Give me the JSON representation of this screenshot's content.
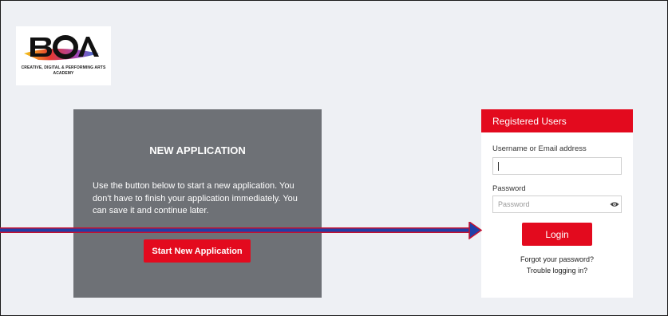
{
  "logo": {
    "tagline_line1": "CREATIVE, DIGITAL & PERFORMING ARTS",
    "tagline_line2": "ACADEMY"
  },
  "new_application": {
    "title": "NEW APPLICATION",
    "description": "Use the button below to start a new application. You don't have to finish your application immediately. You can save it and continue later.",
    "button_label": "Start New Application"
  },
  "login": {
    "header": "Registered Users",
    "username_label": "Username or Email address",
    "username_value": "",
    "password_label": "Password",
    "password_placeholder": "Password",
    "login_button": "Login",
    "forgot_link": "Forgot your password?",
    "trouble_link": "Trouble logging in?"
  },
  "colors": {
    "accent": "#e30a1e",
    "panel_gray": "#6e7176",
    "page_bg": "#eef0f4",
    "arrow_blue": "#1f3fa8"
  },
  "icons": [
    "boa-logo",
    "eye-icon",
    "arrow-annotation"
  ]
}
